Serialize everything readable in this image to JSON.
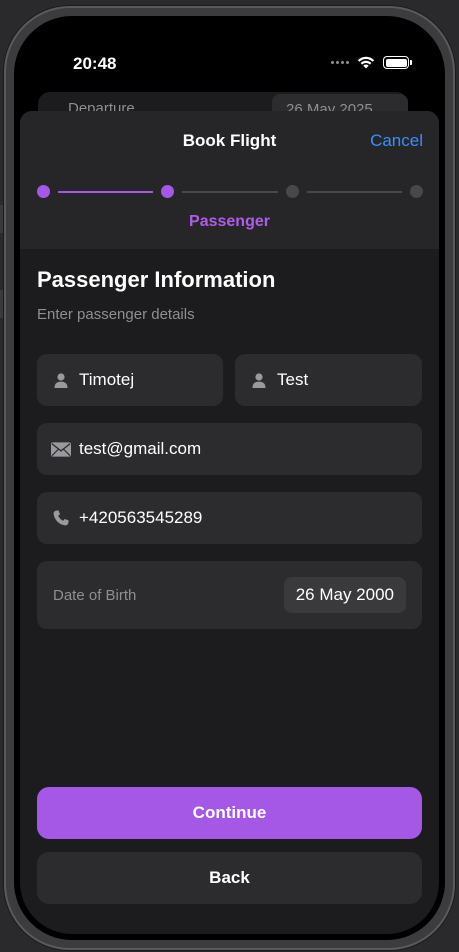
{
  "status_bar": {
    "time": "20:48",
    "icons": [
      "cellular-dots-icon",
      "wifi-icon",
      "battery-icon"
    ]
  },
  "background_screen": {
    "label": "Departure",
    "value": "26 May 2025"
  },
  "sheet": {
    "title": "Book Flight",
    "cancel_label": "Cancel"
  },
  "stepper": {
    "current_step_label": "Passenger",
    "total_steps": 4,
    "completed_through": 2
  },
  "form": {
    "title": "Passenger Information",
    "subtitle": "Enter passenger details",
    "first_name": {
      "icon": "person-icon",
      "value": "Timotej"
    },
    "last_name": {
      "icon": "person-icon",
      "value": "Test"
    },
    "email": {
      "icon": "envelope-icon",
      "value": "test@gmail.com"
    },
    "phone": {
      "icon": "phone-icon",
      "value": "+420563545289"
    },
    "date_of_birth": {
      "label": "Date of Birth",
      "value": "26 May 2000"
    }
  },
  "actions": {
    "continue_label": "Continue",
    "back_label": "Back"
  },
  "colors": {
    "accent": "#a557e6",
    "link": "#3a8dff",
    "inactive_step": "#48484a",
    "background": "#1c1c1e",
    "field": "#2c2c2e"
  }
}
